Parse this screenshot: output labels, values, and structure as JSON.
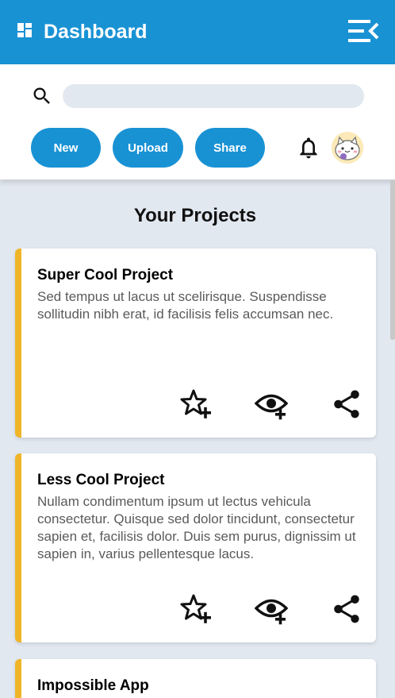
{
  "header": {
    "title": "Dashboard"
  },
  "search": {
    "value": "",
    "placeholder": ""
  },
  "actions": {
    "new_label": "New",
    "upload_label": "Upload",
    "share_label": "Share"
  },
  "main": {
    "section_title": "Your Projects"
  },
  "projects": [
    {
      "title": "Super Cool Project",
      "description": "Sed tempus ut lacus ut scelirisque. Suspendisse sollitudin nibh erat, id facilisis felis accumsan nec."
    },
    {
      "title": "Less Cool Project",
      "description": "Nullam condimentum ipsum ut lectus vehicula consectetur. Quisque sed dolor tincidunt, consectetur sapien et, facilisis dolor. Duis sem purus, dignissim ut sapien in, varius pellentesque lacus."
    },
    {
      "title": "Impossible App",
      "description": ""
    }
  ],
  "colors": {
    "primary": "#1992d4",
    "accent": "#f0b429",
    "background": "#e2e8f0"
  },
  "icons": [
    "dashboard-icon",
    "collapse-menu-icon",
    "search-icon",
    "bell-icon",
    "star-plus-icon",
    "eye-plus-icon",
    "share-icon"
  ]
}
